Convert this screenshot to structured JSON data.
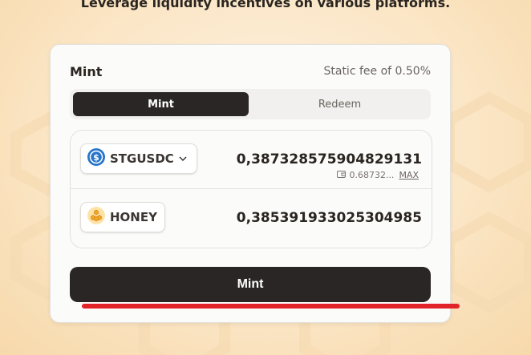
{
  "headline": "Leverage liquidity incentives on various platforms.",
  "card": {
    "title": "Mint",
    "fee_text": "Static fee of 0.50%"
  },
  "tabs": [
    {
      "label": "Mint",
      "active": true
    },
    {
      "label": "Redeem",
      "active": false
    }
  ],
  "input_token": {
    "symbol": "STGUSDC",
    "icon": "usdc-icon",
    "amount": "0,387328575904829131",
    "balance": "0.68732...",
    "max_label": "MAX"
  },
  "output_token": {
    "symbol": "HONEY",
    "icon": "honey-icon",
    "amount": "0,385391933025304985"
  },
  "action": {
    "label": "Mint"
  },
  "colors": {
    "accent_dark": "#2a2625",
    "usdc_blue": "#2775ca",
    "honey_orange": "#f5a623",
    "annotation_red": "#e0242a"
  }
}
